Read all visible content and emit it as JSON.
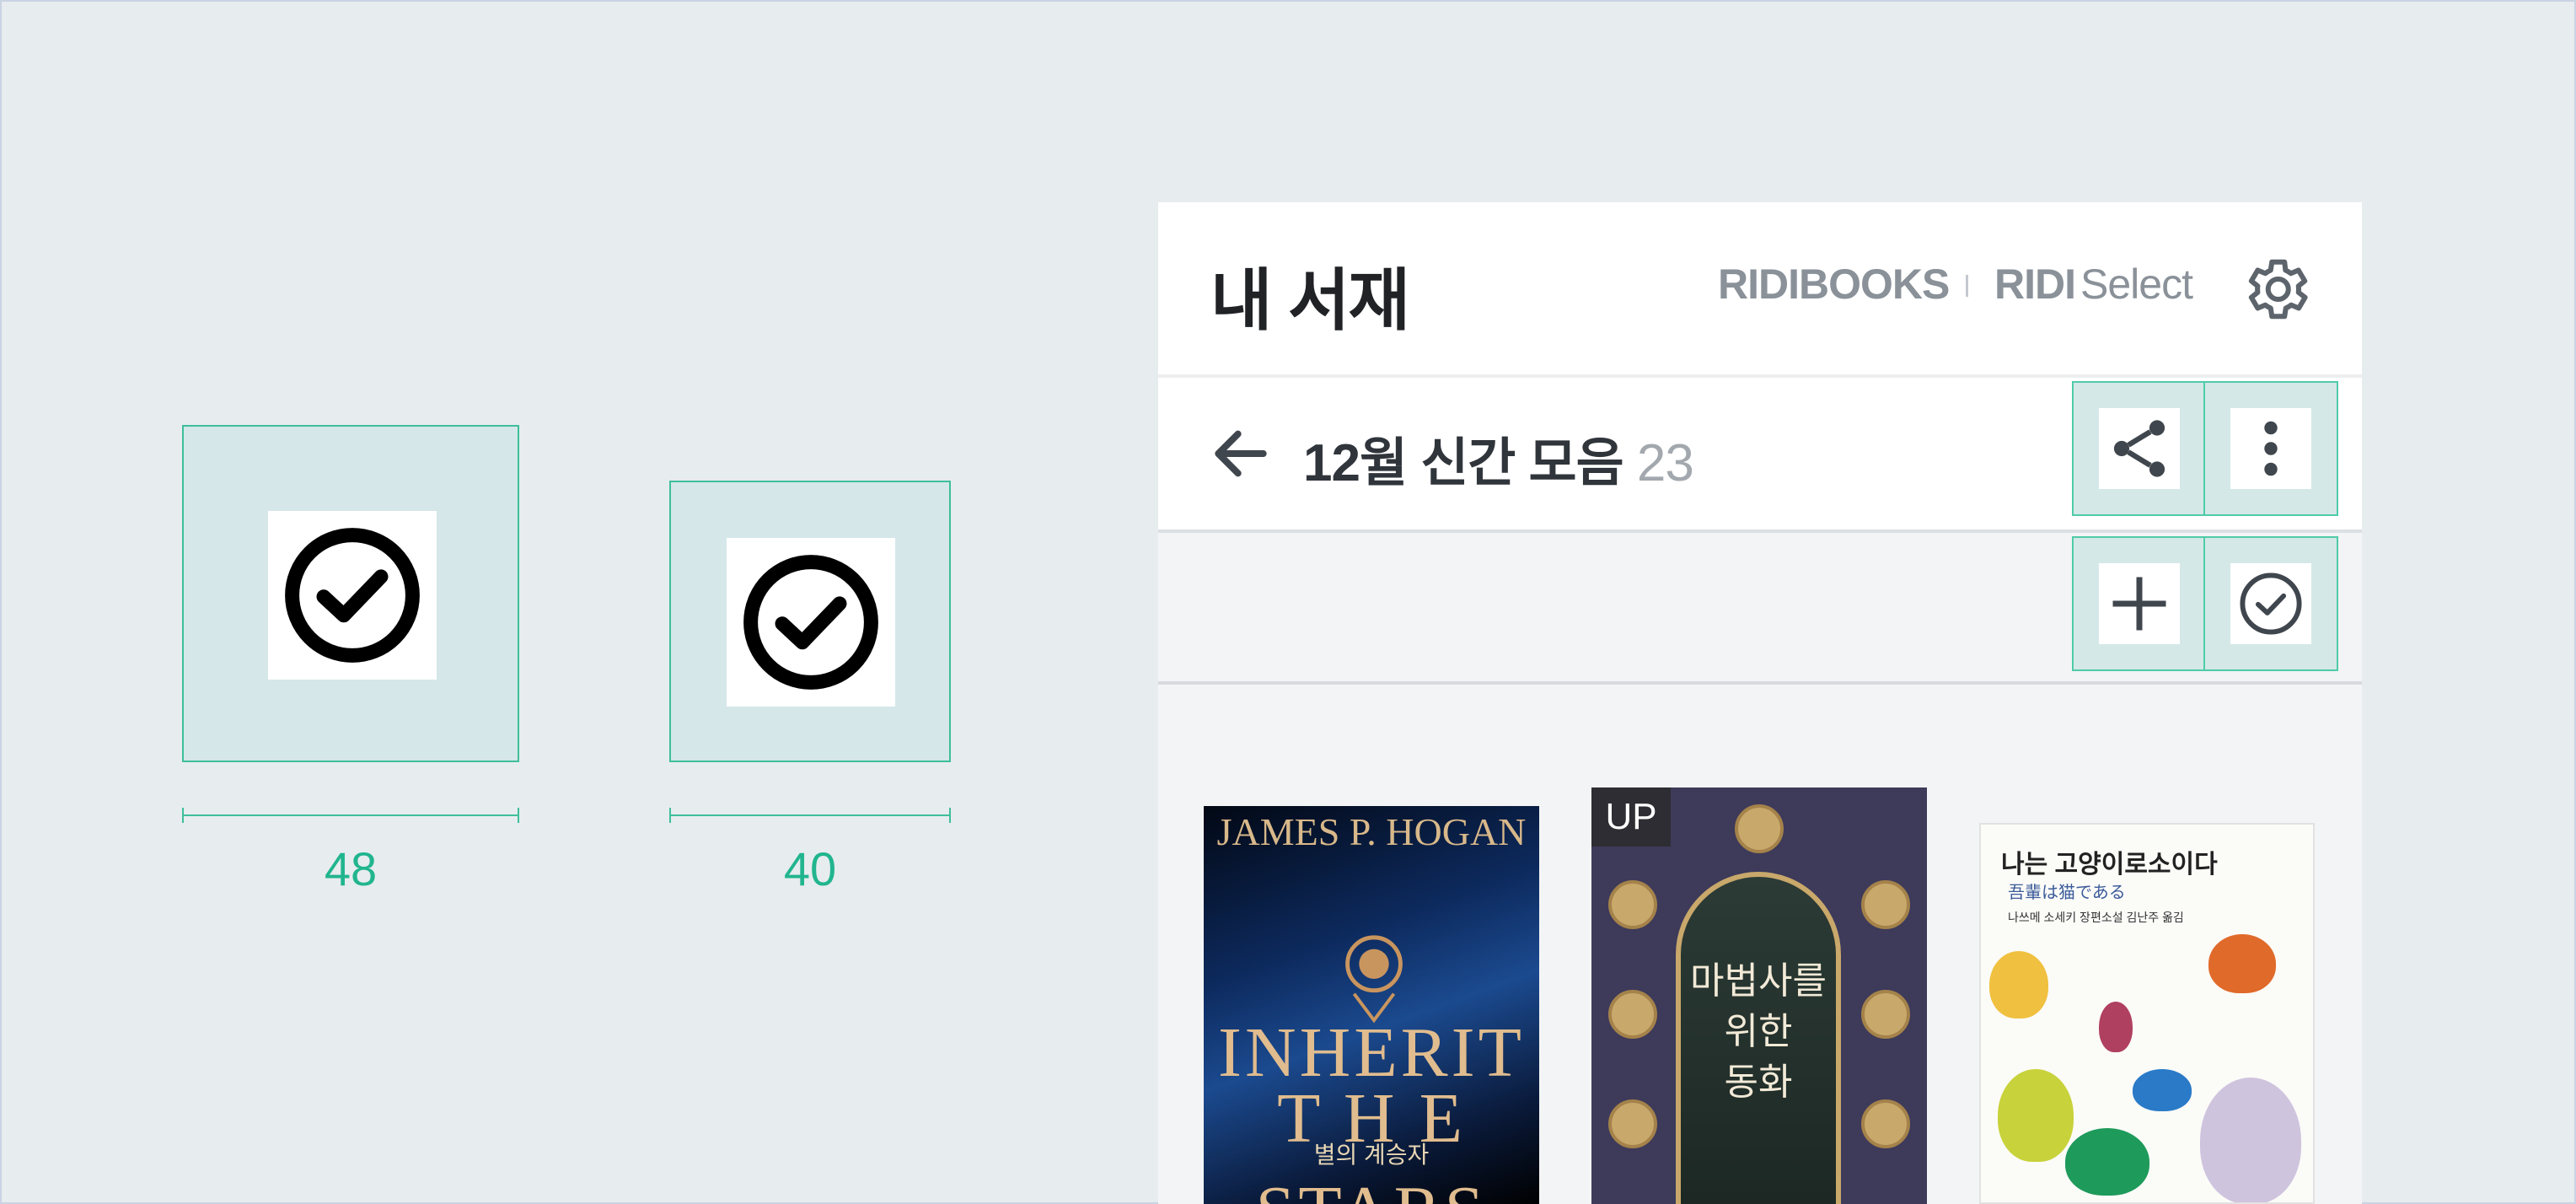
{
  "specimen": {
    "large_size_label": "48",
    "small_size_label": "40",
    "icon": "check-circle-icon",
    "accent_color": "#21b58e"
  },
  "header": {
    "title": "내 서재",
    "brand_primary": "RIDIBOOKS",
    "brand_secondary_bold": "RIDI",
    "brand_secondary_light": "Select",
    "settings_icon": "gear-icon"
  },
  "toolbar": {
    "back_icon": "arrow-left-icon",
    "collection_title": "12월 신간 모음",
    "collection_count": "23",
    "share_icon": "share-icon",
    "more_icon": "more-vertical-icon"
  },
  "action_bar": {
    "add_icon": "plus-icon",
    "select_icon": "check-circle-icon"
  },
  "books": [
    {
      "author": "JAMES P. HOGAN",
      "title_lines": [
        "INHERIT",
        "T  H  E",
        "STARS"
      ],
      "subtitle": "별의 계승자"
    },
    {
      "badge": "UP",
      "title_lines": [
        "마법사를",
        "위한",
        "동화"
      ]
    },
    {
      "title": "나는 고양이로소이다",
      "original_title": "吾輩は猫である",
      "credits": "나쓰메 소세키 장편소설 김난주 옮김"
    }
  ]
}
